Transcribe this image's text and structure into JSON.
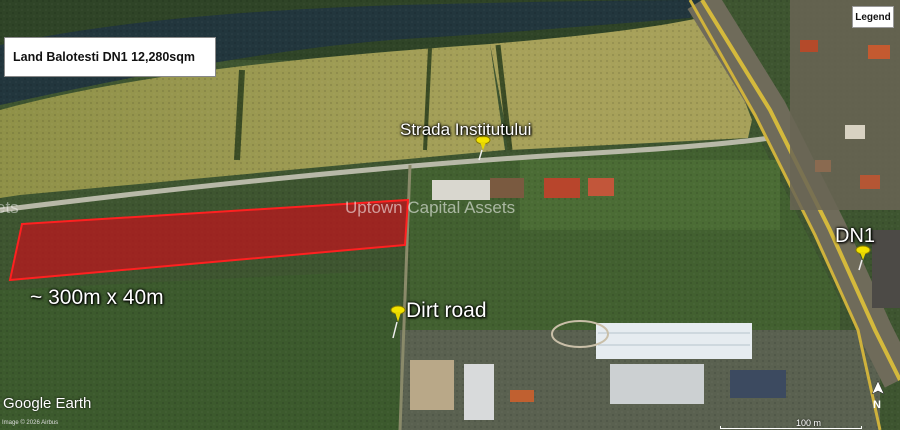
{
  "title_box": {
    "text": "Land Balotesti DN1 12,280sqm"
  },
  "legend_button": {
    "label": "Legend"
  },
  "placemarks": {
    "strada": {
      "label": "Strada Institutului",
      "icon": "yellow-pushpin-icon"
    },
    "dirt_road": {
      "label": "Dirt road",
      "icon": "yellow-pushpin-icon"
    },
    "dn1": {
      "label": "DN1",
      "icon": "yellow-pushpin-icon"
    }
  },
  "dimension_label": "~ 300m x 40m",
  "watermark": "Uptown Capital Assets",
  "watermark_edge": "ets",
  "branding": {
    "logo": "Google Earth",
    "credit": "Image © 2026 Airbus"
  },
  "scale": {
    "label": "100 m"
  },
  "compass": {
    "label": "N",
    "icon": "north-arrow-icon"
  },
  "colors": {
    "parcel_fill": "#c0141c",
    "parcel_stroke": "#ff2020",
    "pin_yellow": "#f2e200",
    "field": "#9a9a4e",
    "river": "#243a40",
    "road": "#c9b23c"
  }
}
